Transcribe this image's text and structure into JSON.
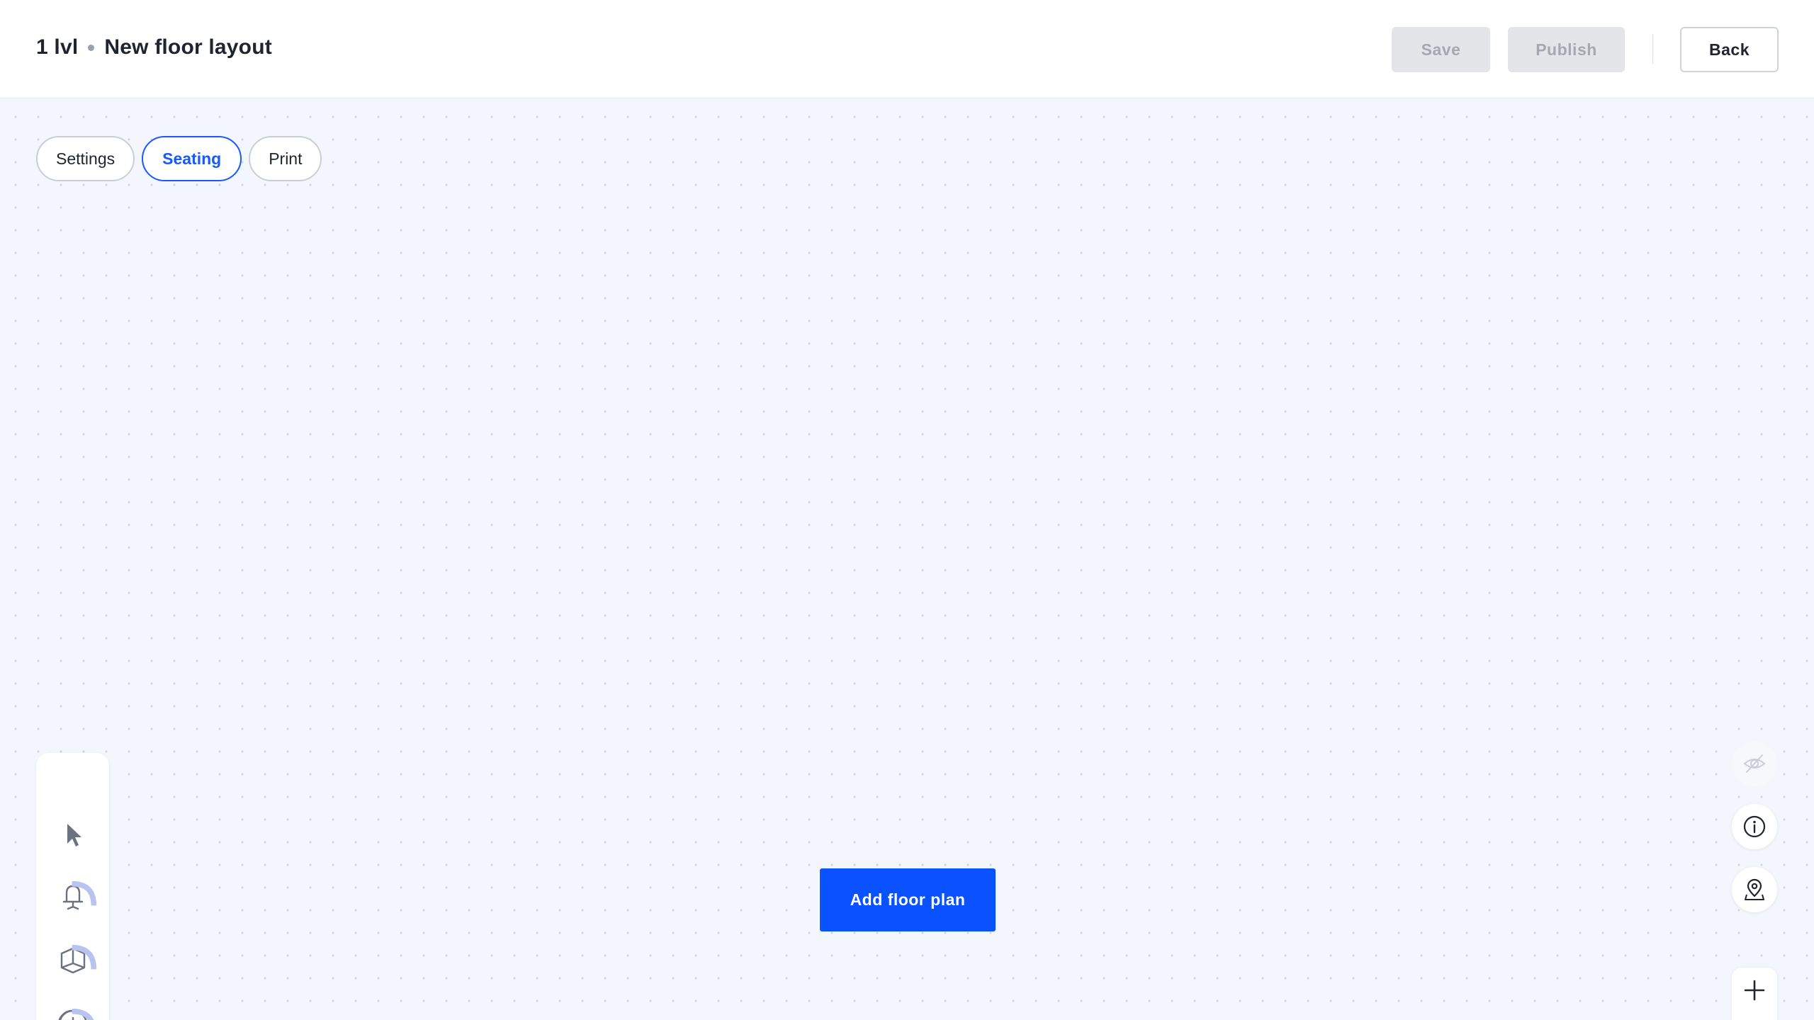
{
  "header": {
    "breadcrumb": [
      "1 lvl",
      "New floor layout"
    ],
    "save_label": "Save",
    "publish_label": "Publish",
    "back_label": "Back"
  },
  "tabs": [
    {
      "label": "Settings",
      "active": false
    },
    {
      "label": "Seating",
      "active": true
    },
    {
      "label": "Print",
      "active": false
    }
  ],
  "toolbar": {
    "tools": [
      "pointer-icon",
      "chair-icon",
      "floor-plan-icon",
      "add-comment-icon"
    ]
  },
  "canvas": {
    "add_floor_plan_label": "Add floor plan"
  },
  "right_controls": [
    "hide-icon",
    "info-icon",
    "location-pin-icon",
    "zoom-in-icon"
  ],
  "colors": {
    "accent": "#0a52ff",
    "canvas_bg": "#f3f6fc",
    "disabled_button": "#e3e5e9"
  }
}
